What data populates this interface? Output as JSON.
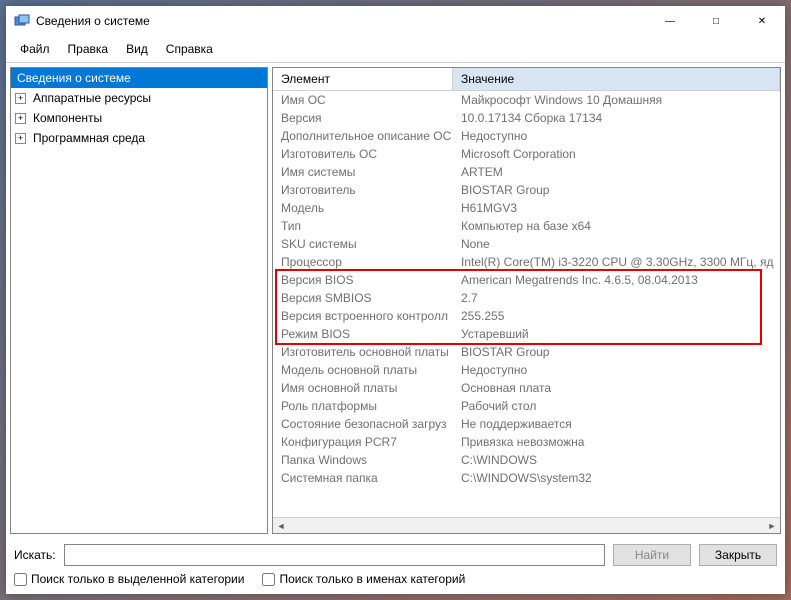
{
  "window": {
    "title": "Сведения о системе",
    "minimize_label": "—",
    "maximize_label": "□",
    "close_label": "✕"
  },
  "menubar": {
    "file": "Файл",
    "edit": "Правка",
    "view": "Вид",
    "help": "Справка"
  },
  "tree": {
    "root": "Сведения о системе",
    "hardware": "Аппаратные ресурсы",
    "components": "Компоненты",
    "software_env": "Программная среда"
  },
  "table_headers": {
    "name": "Элемент",
    "value": "Значение"
  },
  "rows": [
    {
      "name": "Имя ОС",
      "value": "Майкрософт Windows 10 Домашняя"
    },
    {
      "name": "Версия",
      "value": "10.0.17134 Сборка 17134"
    },
    {
      "name": "Дополнительное описание ОС",
      "value": "Недоступно"
    },
    {
      "name": "Изготовитель ОС",
      "value": "Microsoft Corporation"
    },
    {
      "name": "Имя системы",
      "value": "ARTEM"
    },
    {
      "name": "Изготовитель",
      "value": "BIOSTAR Group"
    },
    {
      "name": "Модель",
      "value": "H61MGV3"
    },
    {
      "name": "Тип",
      "value": "Компьютер на базе x64"
    },
    {
      "name": "SKU системы",
      "value": "None"
    },
    {
      "name": "Процессор",
      "value": "Intel(R) Core(TM) i3-3220 CPU @ 3.30GHz, 3300 МГц, яд"
    },
    {
      "name": "Версия BIOS",
      "value": "American Megatrends Inc. 4.6.5, 08.04.2013"
    },
    {
      "name": "Версия SMBIOS",
      "value": "2.7"
    },
    {
      "name": "Версия встроенного контролл",
      "value": "255.255"
    },
    {
      "name": "Режим BIOS",
      "value": "Устаревший"
    },
    {
      "name": "Изготовитель основной платы",
      "value": "BIOSTAR Group"
    },
    {
      "name": "Модель основной платы",
      "value": "Недоступно"
    },
    {
      "name": "Имя основной платы",
      "value": "Основная плата"
    },
    {
      "name": "Роль платформы",
      "value": "Рабочий стол"
    },
    {
      "name": "Состояние безопасной загруз",
      "value": "Не поддерживается"
    },
    {
      "name": "Конфигурация PCR7",
      "value": "Привязка невозможна"
    },
    {
      "name": "Папка Windows",
      "value": "C:\\WINDOWS"
    },
    {
      "name": "Системная папка",
      "value": "C:\\WINDOWS\\system32"
    }
  ],
  "search": {
    "label": "Искать:",
    "placeholder": "",
    "find_btn": "Найти",
    "close_btn": "Закрыть",
    "checkbox1": "Поиск только в выделенной категории",
    "checkbox2": "Поиск только в именах категорий"
  }
}
